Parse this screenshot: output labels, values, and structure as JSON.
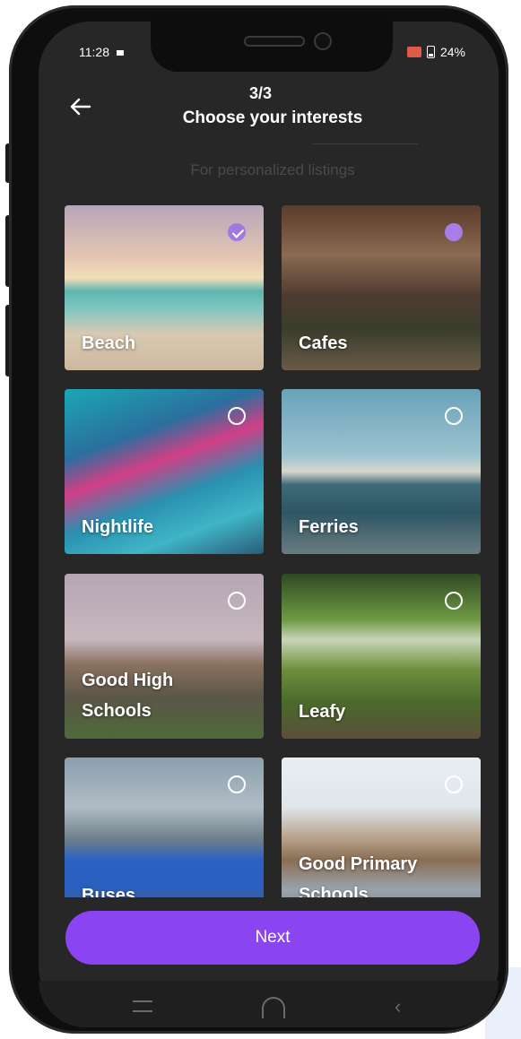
{
  "status": {
    "time": "11:28",
    "battery": "24%"
  },
  "header": {
    "step": "3/3",
    "title": "Choose your interests",
    "subtitle": "For personalized listings"
  },
  "interests": [
    {
      "label": "Beach",
      "state": "checked"
    },
    {
      "label": "Cafes",
      "state": "selected"
    },
    {
      "label": "Nightlife",
      "state": "unchecked"
    },
    {
      "label": "Ferries",
      "state": "unchecked"
    },
    {
      "label": "Good High Schools",
      "state": "unchecked"
    },
    {
      "label": "Leafy",
      "state": "unchecked"
    },
    {
      "label": "Buses",
      "state": "unchecked"
    },
    {
      "label": "Good Primary Schools",
      "state": "unchecked"
    }
  ],
  "footer": {
    "next_label": "Next"
  },
  "icons": {
    "back": "arrow-left-icon",
    "cast": "cast-icon",
    "battery": "battery-icon",
    "nav_recent": "recent-apps-icon",
    "nav_home": "home-icon",
    "nav_back": "nav-back-icon"
  },
  "colors": {
    "accent": "#8a44f2",
    "check": "#a07ae0",
    "background": "#272728"
  }
}
